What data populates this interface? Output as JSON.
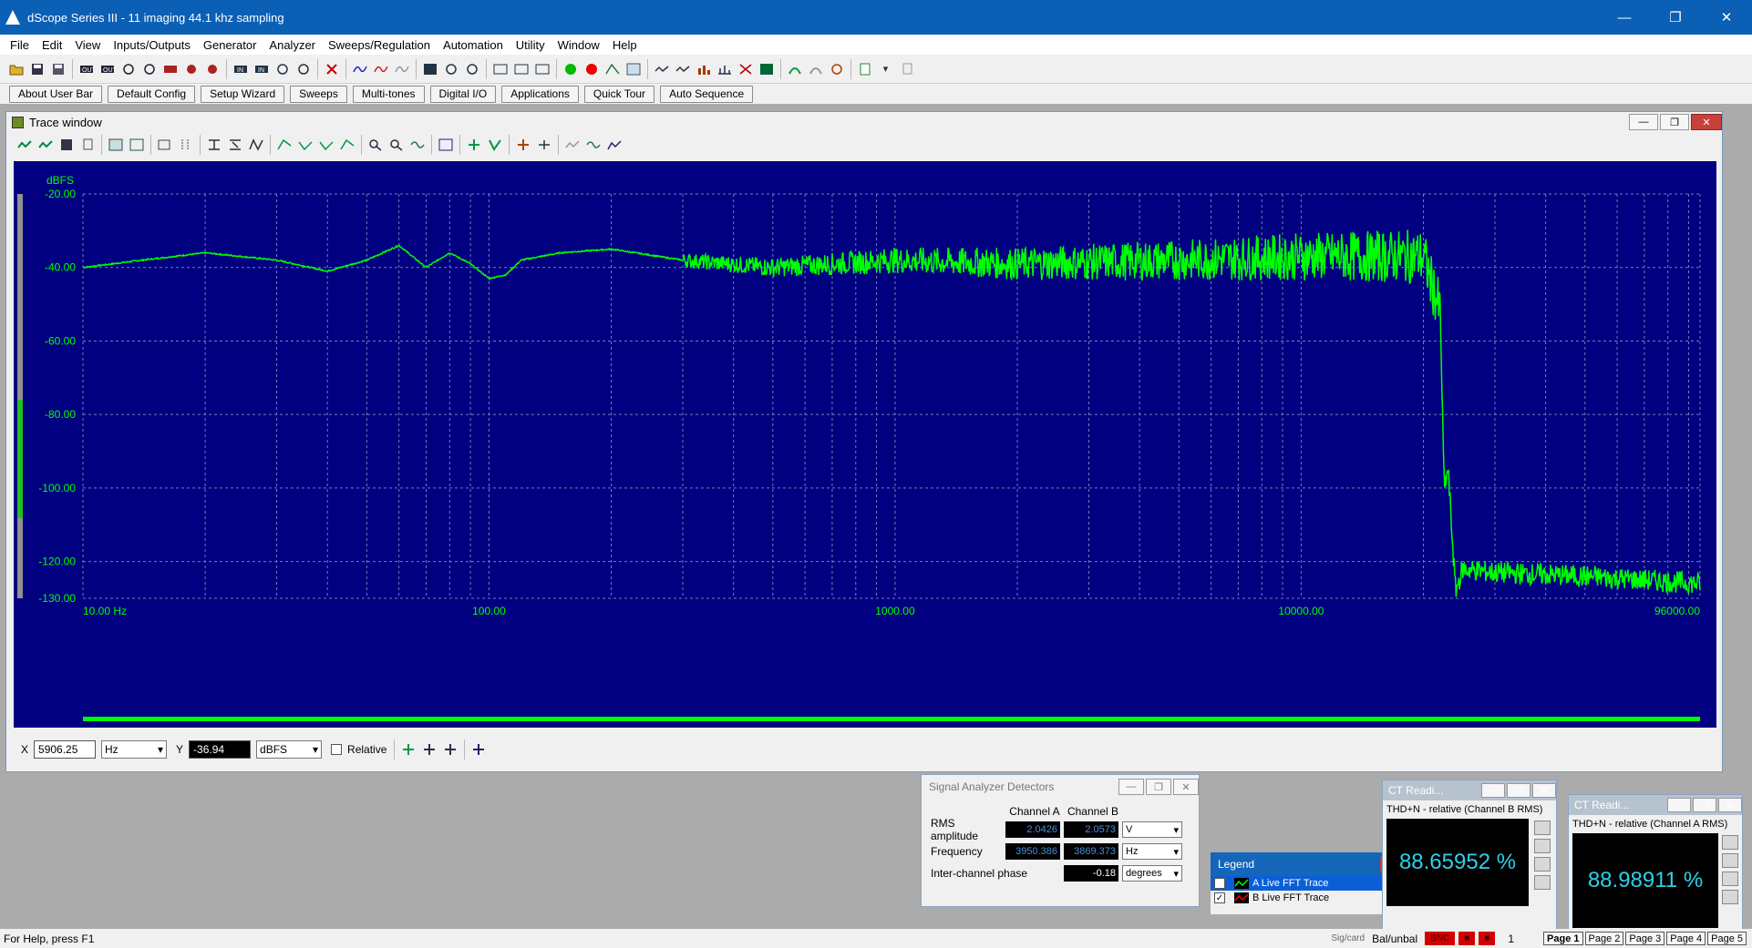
{
  "window": {
    "title": "dScope Series III - 11  imaging 44.1 khz sampling"
  },
  "menu": [
    "File",
    "Edit",
    "View",
    "Inputs/Outputs",
    "Generator",
    "Analyzer",
    "Sweeps/Regulation",
    "Automation",
    "Utility",
    "Window",
    "Help"
  ],
  "userbar": [
    "About User Bar",
    "Default Config",
    "Setup Wizard",
    "Sweeps",
    "Multi-tones",
    "Digital I/O",
    "Applications",
    "Quick Tour",
    "Auto Sequence"
  ],
  "trace_window": {
    "title": "Trace window"
  },
  "chart_data": {
    "type": "line",
    "title": "",
    "ylabel": "dBFS",
    "xlabel": "",
    "x_scale": "log",
    "xlim": [
      10,
      96000
    ],
    "ylim": [
      -130,
      -20
    ],
    "x_tick_labels": [
      "10.00 Hz",
      "100.00",
      "1000.00",
      "10000.00",
      "96000.00"
    ],
    "y_tick_labels": [
      "-20.00",
      "-40.00",
      "-60.00",
      "-80.00",
      "-100.00",
      "-120.00",
      "-130.00"
    ],
    "series": [
      {
        "name": "A Live FFT Trace",
        "color": "#00ff00",
        "x": [
          10,
          14,
          20,
          30,
          40,
          50,
          60,
          70,
          80,
          90,
          100,
          110,
          120,
          150,
          200,
          300,
          500,
          1000,
          2000,
          5000,
          10000,
          20000,
          22000,
          22500,
          23000,
          24000,
          25000,
          30000,
          50000,
          96000
        ],
        "y": [
          -40,
          -38,
          -36,
          -38,
          -41,
          -38,
          -34,
          -40,
          -36,
          -39,
          -43,
          -42,
          -38,
          -36,
          -35,
          -38,
          -40,
          -38,
          -39,
          -38,
          -37,
          -37,
          -52,
          -100,
          -95,
          -128,
          -122,
          -123,
          -124,
          -126
        ]
      },
      {
        "name": "B Live FFT Trace",
        "color": "#00ff00",
        "x": [],
        "y": []
      }
    ]
  },
  "readout": {
    "x_label": "X",
    "x_value": "5906.25",
    "x_unit": "Hz",
    "y_label": "Y",
    "y_value": "-36.94",
    "y_unit": "dBFS",
    "relative_label": "Relative"
  },
  "sad": {
    "title": "Signal Analyzer Detectors",
    "col_a": "Channel A",
    "col_b": "Channel B",
    "rows": [
      {
        "label": "RMS amplitude",
        "a": "2.0426",
        "b": "2.0573",
        "unit": "V"
      },
      {
        "label": "Frequency",
        "a": "3950.386",
        "b": "3869.373",
        "unit": "Hz"
      },
      {
        "label": "Inter-channel phase",
        "a": "",
        "b": "-0.18",
        "unit": "degrees"
      }
    ]
  },
  "legend": {
    "title": "Legend",
    "items": [
      {
        "label": "A  Live FFT Trace",
        "color": "#00ff00"
      },
      {
        "label": "B  Live FFT Trace",
        "color": "#ff0000"
      }
    ]
  },
  "ct1": {
    "title": "CT Readi...",
    "subtitle": "THD+N - relative (Channel B RMS)",
    "value": "88.65952 %"
  },
  "ct2": {
    "title": "CT Readi...",
    "subtitle": "THD+N - relative (Channel A RMS)",
    "value": "88.98911 %"
  },
  "status": {
    "help": "For Help, press F1",
    "sig": "Sig/card",
    "balunbal": "Bal/unbal",
    "bnc": "BNC",
    "num": "1",
    "pages": [
      "Page 1",
      "Page 2",
      "Page 3",
      "Page 4",
      "Page 5"
    ]
  }
}
